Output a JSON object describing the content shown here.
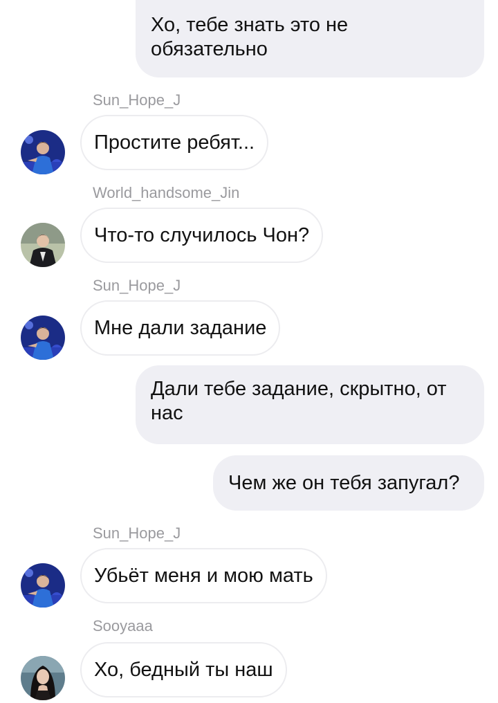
{
  "messages": [
    {
      "type": "outgoing",
      "text": "Хо, тебе знать это не обязательно"
    },
    {
      "type": "incoming",
      "sender": "Sun_Hope_J",
      "avatar_icon": "blue-stage-person-avatar",
      "text": "Простите ребят..."
    },
    {
      "type": "incoming",
      "sender": "World_handsome_Jin",
      "avatar_icon": "dark-suit-person-avatar",
      "text": "Что-то случилось Чон?"
    },
    {
      "type": "incoming",
      "sender": "Sun_Hope_J",
      "avatar_icon": "blue-stage-person-avatar",
      "text": "Мне дали задание"
    },
    {
      "type": "outgoing",
      "text": "Дали тебе задание, скрытно, от нас"
    },
    {
      "type": "outgoing",
      "text": "Чем же он тебя запугал?"
    },
    {
      "type": "incoming",
      "sender": "Sun_Hope_J",
      "avatar_icon": "blue-stage-person-avatar",
      "text": "Убьёт меня и мою мать"
    },
    {
      "type": "incoming",
      "sender": "Sooyaaa",
      "avatar_icon": "dark-hair-woman-avatar",
      "text": "Хо, бедный ты наш"
    }
  ],
  "colors": {
    "outgoing_bubble": "#efeff4",
    "incoming_bubble_border": "#ececef",
    "sender_name": "#9a9a9e",
    "text": "#111111"
  }
}
